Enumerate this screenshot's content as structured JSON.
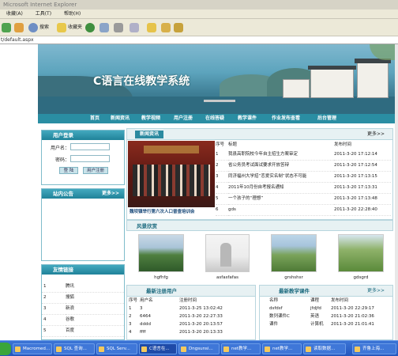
{
  "window": {
    "title": "Microsoft Internet Explorer"
  },
  "menu": [
    "收藏(A)",
    "工具(T)",
    "帮助(H)"
  ],
  "toolbar": {
    "search": "搜索",
    "favorites": "收藏夹"
  },
  "address": "t/default.aspx",
  "site": {
    "title": "C语言在线教学系统"
  },
  "nav": [
    "首页",
    "新闻资讯",
    "教学视频",
    "用户注册",
    "在线答疑",
    "教学课件",
    "作业发布查看",
    "后台管理"
  ],
  "login": {
    "title": "用户登录",
    "username_label": "用户名：",
    "password_label": "密码：",
    "username_value": "",
    "password_value": "",
    "login_btn": "登 陆",
    "register_btn": "用户注册"
  },
  "notice": {
    "title": "站内公告",
    "more": "更多>>"
  },
  "links": {
    "title": "友情链接",
    "cols": [
      "",
      ""
    ],
    "rows": [
      {
        "n": "1",
        "name": "腾讯"
      },
      {
        "n": "2",
        "name": "搜狐"
      },
      {
        "n": "3",
        "name": "新浪"
      },
      {
        "n": "4",
        "name": "谷歌"
      },
      {
        "n": "5",
        "name": "百度"
      }
    ]
  },
  "news": {
    "tab": "新闻资讯",
    "more": "更多>>",
    "caption": "魏坝镇举行第六次人口普查培训会",
    "cols": [
      "序号",
      "标题",
      "发布时间"
    ],
    "rows": [
      {
        "n": "1",
        "title": "我县高职院校今年自主招生方案审定",
        "time": "2011-3-20 17:12:14"
      },
      {
        "n": "2",
        "title": "省公务员考试面试要求开放答辩",
        "time": "2011-3-20 17:12:54"
      },
      {
        "n": "3",
        "title": "同济福州大学招“恋爱实名制”状态不可能",
        "time": "2011-3-20 17:13:15"
      },
      {
        "n": "4",
        "title": "2011年10月份自考报名通知",
        "time": "2011-3-20 17:13:31"
      },
      {
        "n": "5",
        "title": "一个孩子的“理想”",
        "time": "2011-3-20 17:13:48"
      },
      {
        "n": "6",
        "title": "gds",
        "time": "2011-3-20 22:28:40"
      }
    ]
  },
  "scenery": {
    "title": "风景欣赏",
    "items": [
      "hgfhfg",
      "asfasfafas",
      "grshshsr",
      "gdsgrd"
    ]
  },
  "users": {
    "title": "最新注册用户",
    "cols": [
      "序号",
      "用户名",
      "注册时间"
    ],
    "rows": [
      {
        "n": "1",
        "name": "3",
        "time": "2011-3-25 13:02:42"
      },
      {
        "n": "2",
        "name": "6464",
        "time": "2011-3-20 22:27:33"
      },
      {
        "n": "3",
        "name": "dddd",
        "time": "2011-3-20 20:13:57"
      },
      {
        "n": "4",
        "name": "ffff",
        "time": "2011-3-20 20:13:33"
      }
    ]
  },
  "courseware": {
    "title": "最新教学课件",
    "more": "更多>>",
    "cols": [
      "名称",
      "课程",
      "发布时间"
    ],
    "rows": [
      {
        "name": "dsfdsf",
        "course": "jfdjfd",
        "time": "2011-3-20 22:29:17"
      },
      {
        "name": "数列课件C",
        "course": "英语",
        "time": "2011-3-20 21:02:36"
      },
      {
        "name": "课件",
        "course": "计算机",
        "time": "2011-3-20 21:01:41"
      }
    ]
  },
  "taskbar": [
    "Macromed...",
    "SQL 查询...",
    "SQL Serv...",
    "C语言在...",
    "Dngsunsi...",
    "net教学...",
    "net教学...",
    "读取数据...",
    "齐鲁上海..."
  ],
  "colors": {
    "accent": "#2a8ea3",
    "panel_border": "#7fbccb",
    "taskbar": "#2356bd"
  }
}
